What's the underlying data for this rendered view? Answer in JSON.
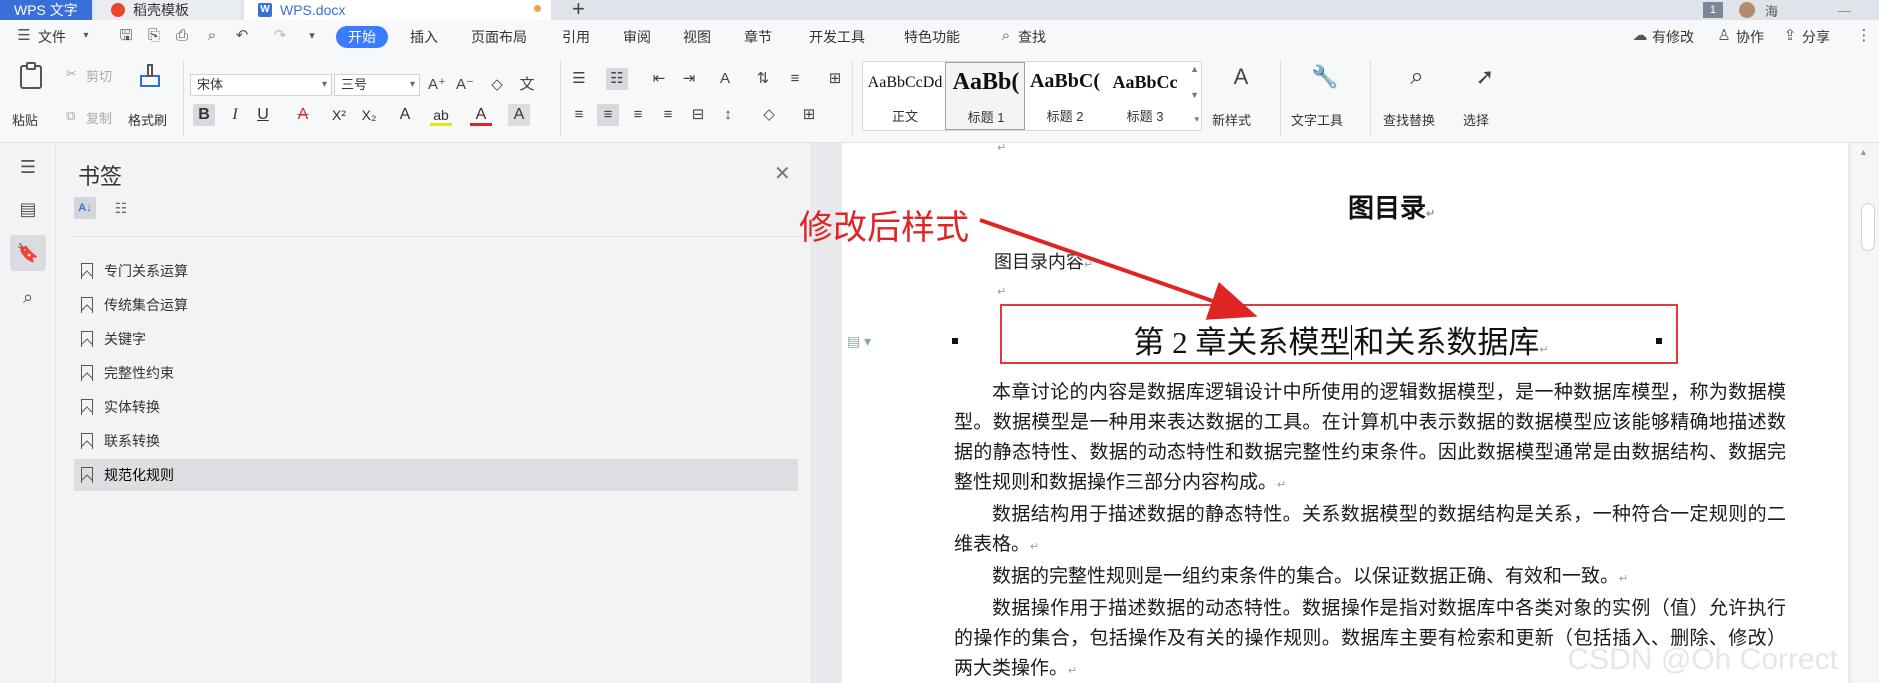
{
  "tabs": [
    {
      "label": "WPS 文字"
    },
    {
      "label": "稻壳模板"
    },
    {
      "label": "WPS.docx"
    }
  ],
  "titlebar": {
    "page_badge": "1",
    "user_name": "海"
  },
  "menu": {
    "file": "文件",
    "items": [
      "开始",
      "插入",
      "页面布局",
      "引用",
      "审阅",
      "视图",
      "章节",
      "开发工具",
      "特色功能",
      "查找"
    ],
    "right": [
      "有修改",
      "协作",
      "分享"
    ]
  },
  "ribbon": {
    "paste": "粘贴",
    "cut": "剪切",
    "copy": "复制",
    "format_painter": "格式刷",
    "font_name": "宋体",
    "font_size": "三号",
    "styles": [
      {
        "sample": "AaBbCcDd",
        "label": "正文"
      },
      {
        "sample": "AaBb(",
        "label": "标题 1"
      },
      {
        "sample": "AaBbC(",
        "label": "标题 2"
      },
      {
        "sample": "AaBbCc",
        "label": "标题 3"
      }
    ],
    "new_style": "新样式",
    "text_tools": "文字工具",
    "find_replace": "查找替换",
    "select": "选择"
  },
  "panel": {
    "title": "书签",
    "bookmarks": [
      "专门关系运算",
      "传统集合运算",
      "关键字",
      "完整性约束",
      "实体转换",
      "联系转换",
      "规范化规则"
    ],
    "selected_index": 6
  },
  "document": {
    "title": "图目录",
    "toc_line": "图目录内容",
    "heading_before_cursor": "第 2 章关系模型",
    "heading_after_cursor": "和关系数据库",
    "paragraphs": [
      "本章讨论的内容是数据库逻辑设计中所使用的逻辑数据模型，是一种数据库模型，称为数据模型。数据模型是一种用来表达数据的工具。在计算机中表示数据的数据模型应该能够精确地描述数据的静态特性、数据的动态特性和数据完整性约束条件。因此数据模型通常是由数据结构、数据完整性规则和数据操作三部分内容构成。",
      "数据结构用于描述数据的静态特性。关系数据模型的数据结构是关系，一种符合一定规则的二维表格。",
      "数据的完整性规则是一组约束条件的集合。以保证数据正确、有效和一致。",
      "数据操作用于描述数据的动态特性。数据操作是指对数据库中各类对象的实例（值）允许执行的操作的集合，包括操作及有关的操作规则。数据库主要有检索和更新（包括插入、删除、修改）两大类操作。"
    ],
    "watermark": "CSDN @Oh Correct"
  },
  "annotation": {
    "text": "修改后样式",
    "color": "#e02424"
  },
  "colors": {
    "accent": "#3a7cff",
    "annotation_red": "#e02424"
  }
}
